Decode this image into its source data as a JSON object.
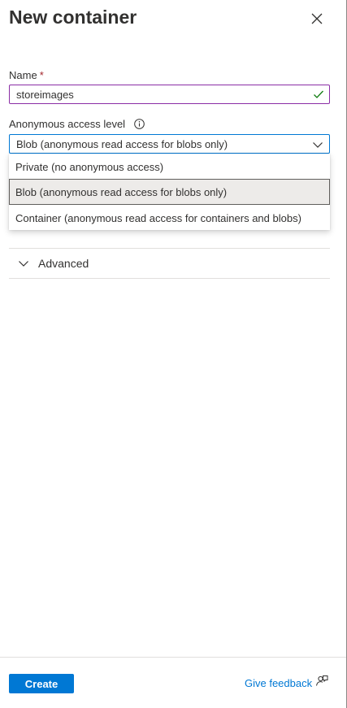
{
  "header": {
    "title": "New container"
  },
  "form": {
    "name_label": "Name",
    "required_mark": "*",
    "name_value": "storeimages",
    "access_label": "Anonymous access level",
    "access_selected": "Blob (anonymous read access for blobs only)",
    "options": [
      {
        "label": "Private (no anonymous access)",
        "selected": false
      },
      {
        "label": "Blob (anonymous read access for blobs only)",
        "selected": true
      },
      {
        "label": "Container (anonymous read access for containers and blobs)",
        "selected": false
      }
    ]
  },
  "advanced": {
    "label": "Advanced"
  },
  "footer": {
    "create_label": "Create",
    "feedback_label": "Give feedback"
  },
  "colors": {
    "accent": "#0078d4",
    "valid_check": "#107c10",
    "name_border": "#8a2da5"
  },
  "icons": [
    "close-icon",
    "checkmark-icon",
    "info-icon",
    "chevron-down-icon",
    "feedback-icon"
  ]
}
